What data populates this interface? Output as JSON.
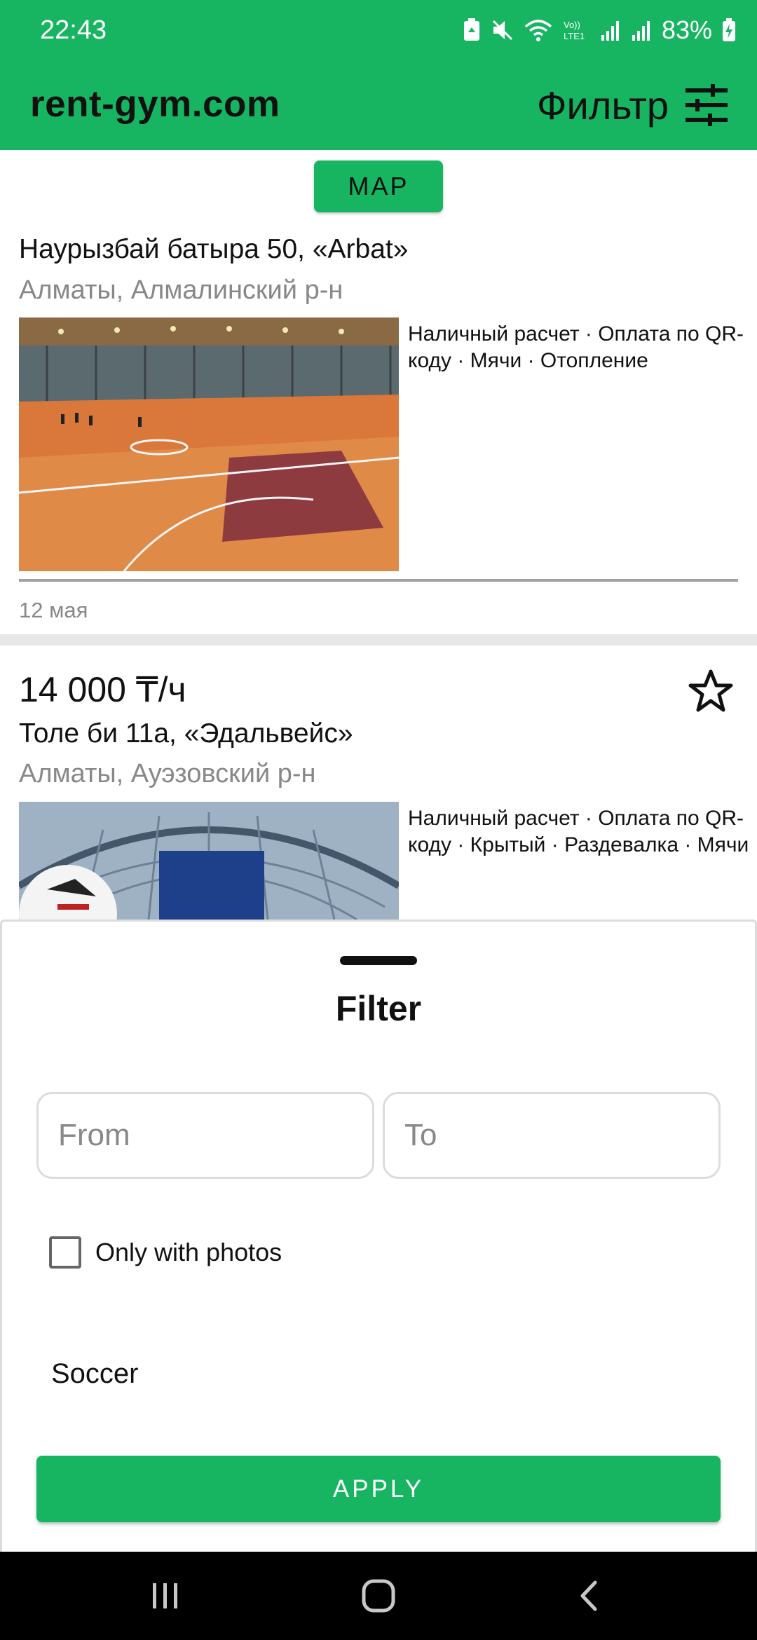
{
  "status_bar": {
    "time": "22:43",
    "battery": "83%",
    "icons": [
      "recycle-icon",
      "mute-icon",
      "wifi-icon",
      "volte-icon",
      "signal-icon",
      "signal-icon",
      "battery-charging-icon"
    ]
  },
  "header": {
    "brand": "rent-gym.com",
    "filter_label": "Фильтр",
    "filter_icon": "tune-icon",
    "background": "#17b562"
  },
  "map_button": {
    "label": "MAP"
  },
  "listings": [
    {
      "address": "Наурызбай батыра 50, «Arbat»",
      "district": "Алматы, Алмалинский р-н",
      "tags": "Наличный расчет · Оплата по QR-коду · Мячи · Отопление",
      "date": "12 мая"
    },
    {
      "price": "14 000 ₸/ч",
      "address": "Толе би 11а, «Эдальвейс»",
      "district": "Алматы, Ауэзовский р-н",
      "tags": "Наличный расчет · Оплата по QR-коду · Крытый · Раздевалка · Мячи",
      "favorite_icon": "star-outline-icon"
    }
  ],
  "filter_sheet": {
    "title": "Filter",
    "from_placeholder": "From",
    "to_placeholder": "To",
    "only_photos_label": "Only with photos",
    "only_photos_checked": false,
    "sport": "Soccer",
    "apply_label": "APPLY"
  },
  "nav_bar": {
    "icons": [
      "recents-icon",
      "home-icon",
      "back-icon"
    ]
  }
}
